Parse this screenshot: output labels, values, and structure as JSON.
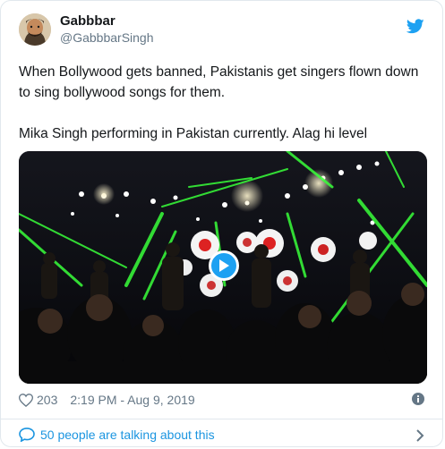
{
  "tweet": {
    "display_name": "Gabbbar",
    "handle": "@GabbbarSingh",
    "text_line1": "When Bollywood gets banned, Pakistanis get singers flown down to sing bollywood songs for them.",
    "text_line2": "Mika Singh performing in Pakistan currently. Alag hi level",
    "likes": "203",
    "timestamp": "2:19 PM - Aug 9, 2019",
    "talking": "50 people are talking about this"
  },
  "icons": {
    "brand": "twitter-bird-icon",
    "like": "heart-icon",
    "info": "info-icon",
    "play": "play-icon",
    "conversation": "chat-bubble-icon",
    "chevron": "chevron-right-icon"
  },
  "colors": {
    "brand_blue": "#1da1f2",
    "link_blue": "#1b95e0",
    "muted": "#657786",
    "text": "#14171a",
    "laser_green": "#39ff3a"
  }
}
